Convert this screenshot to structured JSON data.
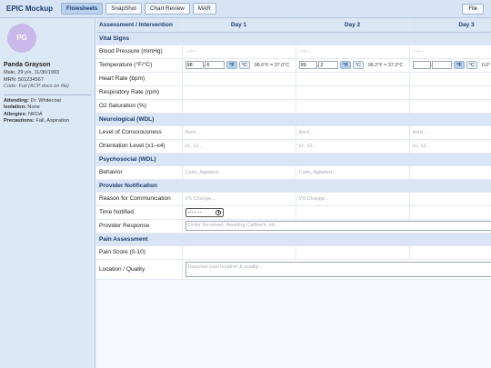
{
  "app": {
    "title": "EPIC Mockup",
    "file_label": "File"
  },
  "tabs": [
    {
      "label": "Flowsheets",
      "active": true
    },
    {
      "label": "SnapShot",
      "active": false
    },
    {
      "label": "Chart Review",
      "active": false
    },
    {
      "label": "MAR",
      "active": false
    }
  ],
  "patient": {
    "initials": "PG",
    "name": "Panda Grayson",
    "demographics": "Male, 29 y/o, 11/30/1993",
    "mrn": "MRN: 501234567",
    "code": "Code: Full (ACP docs on file)",
    "attending": {
      "label": "Attending:",
      "value": " Dr. Whitecoat"
    },
    "isolation": {
      "label": "Isolation:",
      "value": " None"
    },
    "allergies": {
      "label": "Allergies:",
      "value": " NKDA"
    },
    "precautions": {
      "label": "Precautions:",
      "value": " Fall, Aspiration"
    }
  },
  "grid": {
    "header": "Assessment / Intervention",
    "days": [
      "Day 1",
      "Day 2",
      "Day 3"
    ],
    "sections": {
      "vitals": "Vital Signs",
      "neuro": "Neurological (WDL)",
      "psych": "Psychosocial (WDL)",
      "provider": "Provider Notification",
      "pain": "Pain Assessment"
    },
    "rows": {
      "bp": {
        "label": "Blood Pressure (mmHg)",
        "placeholder": "---/---"
      },
      "temp": {
        "label": "Temperature (°F/°C)",
        "unit_f": "°F",
        "unit_c": "°C",
        "day1": {
          "whole": "98",
          "decimal": "6",
          "conversion": "98.6°F = 37.0°C"
        },
        "day2": {
          "whole": "99",
          "decimal": "2",
          "conversion": "99.2°F = 37.3°C"
        },
        "day3": {
          "whole": "",
          "decimal": "",
          "conversion": "0.0°"
        }
      },
      "hr": {
        "label": "Heart Rate (bpm)"
      },
      "rr": {
        "label": "Respiratory Rate (rpm)"
      },
      "o2": {
        "label": "O2 Saturation (%)"
      },
      "loc": {
        "label": "Level of Consciousness",
        "placeholder": "Alert..."
      },
      "orient": {
        "label": "Orientation Level (x1–x4)",
        "placeholder": "x1, x2..."
      },
      "behavior": {
        "label": "Behavior",
        "placeholder": "Calm, Agitated..."
      },
      "reason": {
        "label": "Reason for Communication",
        "placeholder": "VS Change..."
      },
      "time": {
        "label": "Time Notified",
        "value": "--:-- --"
      },
      "response": {
        "label": "Provider Response",
        "placeholder": "Order Received, Awaiting Callback, etc."
      },
      "pain_score": {
        "label": "Pain Score (0-10)"
      },
      "location": {
        "label": "Location / Quality",
        "placeholder": "Describe pain location & quality..."
      }
    }
  }
}
